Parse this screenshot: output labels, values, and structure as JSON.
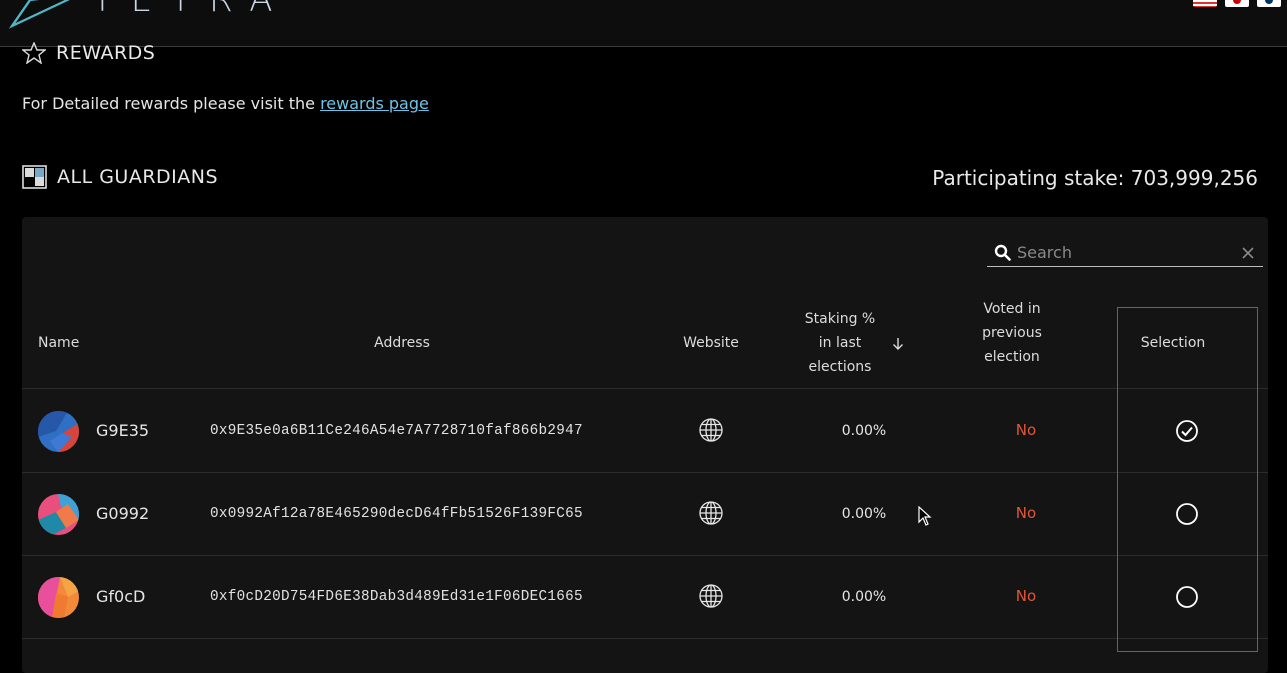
{
  "header": {
    "logo_text": "TETRA",
    "flags": [
      "us-flag-icon",
      "jp-flag-icon",
      "kr-flag-icon"
    ]
  },
  "rewards": {
    "title": "REWARDS",
    "text_prefix": "For Detailed rewards please visit the ",
    "link_text": "rewards page"
  },
  "guardians": {
    "title": "ALL GUARDIANS",
    "stake_label": "Participating stake: 703,999,256"
  },
  "search": {
    "placeholder": "Search",
    "value": ""
  },
  "table": {
    "columns": {
      "name": "Name",
      "address": "Address",
      "website": "Website",
      "staking": "Staking % in last elections",
      "voted": "Voted in previous election",
      "selection": "Selection"
    },
    "rows": [
      {
        "name": "G9E35",
        "address": "0x9E35e0a6B11Ce246A54e7A7728710faf866b2947",
        "staking": "0.00%",
        "voted": "No",
        "selected": true
      },
      {
        "name": "G0992",
        "address": "0x0992Af12a78E465290decD64fFb51526F139FC65",
        "staking": "0.00%",
        "voted": "No",
        "selected": false
      },
      {
        "name": "Gf0cD",
        "address": "0xf0cD20D754FD6E38Dab3d489Ed31e1F06DEC1665",
        "staking": "0.00%",
        "voted": "No",
        "selected": false
      }
    ]
  },
  "colors": {
    "background": "#000000",
    "panel": "#141414",
    "link": "#6ec3e6",
    "no_text": "#e2553a",
    "highlight_box": "#d9342b"
  }
}
